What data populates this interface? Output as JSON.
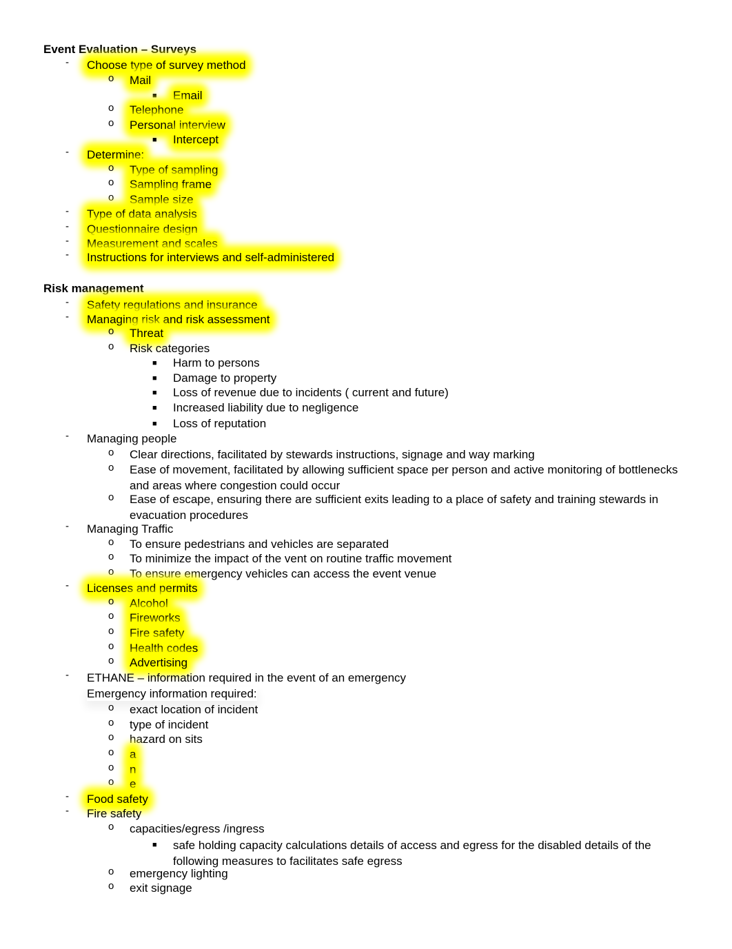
{
  "sections": [
    {
      "title": "Event Evaluation – Surveys",
      "items": [
        {
          "level": 1,
          "text": "Choose type of survey method",
          "highlight": true
        },
        {
          "level": 2,
          "text": "Mail",
          "highlight": true
        },
        {
          "level": 3,
          "text": "Email",
          "highlight": true
        },
        {
          "level": 2,
          "text": "Telephone",
          "highlight": true
        },
        {
          "level": 2,
          "text": "Personal interview",
          "highlight": true
        },
        {
          "level": 3,
          "text": "Intercept",
          "highlight": true
        },
        {
          "level": 1,
          "text": "Determine:",
          "highlight": true
        },
        {
          "level": 2,
          "text": "Type of sampling",
          "highlight": true
        },
        {
          "level": 2,
          "text": "Sampling frame",
          "highlight": true
        },
        {
          "level": 2,
          "text": "Sample size",
          "highlight": true
        },
        {
          "level": 1,
          "text": "Type of data analysis",
          "highlight": true
        },
        {
          "level": 1,
          "text": "Questionnaire design",
          "highlight": true
        },
        {
          "level": 1,
          "text": "Measurement and scales",
          "highlight": true
        },
        {
          "level": 1,
          "text": "Instructions for interviews and self-administered",
          "highlight": true
        }
      ]
    },
    {
      "title": "Risk management",
      "items": [
        {
          "level": 1,
          "text": "Safety regulations and insurance",
          "highlight": true
        },
        {
          "level": 1,
          "text": "Managing risk and risk assessment",
          "highlight": true
        },
        {
          "level": 2,
          "text": "Threat",
          "highlight": true
        },
        {
          "level": 2,
          "text": "Risk categories",
          "highlight": false
        },
        {
          "level": 3,
          "text": "Harm to persons",
          "highlight": false
        },
        {
          "level": 3,
          "text": "Damage to property",
          "highlight": false
        },
        {
          "level": 3,
          "text": "Loss of revenue due to incidents ( current and future)",
          "highlight": false
        },
        {
          "level": 3,
          "text": "Increased liability due to negligence",
          "highlight": false
        },
        {
          "level": 3,
          "text": "Loss of reputation",
          "highlight": false
        },
        {
          "level": 1,
          "text": "Managing people",
          "highlight": false
        },
        {
          "level": 2,
          "text": "Clear directions, facilitated by stewards instructions, signage and way marking",
          "highlight": false
        },
        {
          "level": 2,
          "text": "Ease of movement, facilitated by allowing sufficient space per person and active monitoring of bottlenecks and areas where congestion could occur",
          "highlight": false
        },
        {
          "level": 2,
          "text": "Ease of escape, ensuring there are sufficient exits leading to a place of safety and training stewards in evacuation procedures",
          "highlight": false
        },
        {
          "level": 1,
          "text": "Managing Traffic",
          "highlight": false
        },
        {
          "level": 2,
          "text": "To ensure pedestrians and vehicles are separated",
          "highlight": false
        },
        {
          "level": 2,
          "text": "To minimize the impact of the vent on routine traffic movement",
          "highlight": false
        },
        {
          "level": 2,
          "text": "To ensure emergency vehicles can access the event venue",
          "highlight": false
        },
        {
          "level": 1,
          "text": "Licenses and permits",
          "highlight": true
        },
        {
          "level": 2,
          "text": "Alcohol",
          "highlight": true
        },
        {
          "level": 2,
          "text": "Fireworks",
          "highlight": true
        },
        {
          "level": 2,
          "text": "Fire safety",
          "highlight": true
        },
        {
          "level": 2,
          "text": "Health codes",
          "highlight": true
        },
        {
          "level": 2,
          "text": "Advertising",
          "highlight": true
        },
        {
          "level": 1,
          "text": "ETHANE – information required in the event of an emergency",
          "highlight": false
        },
        {
          "level": 1,
          "text": "Emergency information required:",
          "highlight": false,
          "continuation": true
        },
        {
          "level": 2,
          "text": "exact location of incident",
          "highlight": false
        },
        {
          "level": 2,
          "text": "type of incident",
          "highlight": false
        },
        {
          "level": 2,
          "text": "hazard on sits",
          "highlight": false
        },
        {
          "level": 2,
          "text": "a",
          "highlight": true
        },
        {
          "level": 2,
          "text": "n",
          "highlight": true
        },
        {
          "level": 2,
          "text": "e",
          "highlight": true
        },
        {
          "level": 1,
          "text": "Food safety",
          "highlight": true
        },
        {
          "level": 1,
          "text": "Fire safety",
          "highlight": false
        },
        {
          "level": 2,
          "text": "capacities/egress /ingress",
          "highlight": false
        },
        {
          "level": 3,
          "text": "safe holding capacity calculations details of access and egress for the disabled details of the following measures to facilitates safe egress",
          "highlight": false
        },
        {
          "level": 2,
          "text": "emergency lighting",
          "highlight": false
        },
        {
          "level": 2,
          "text": "exit signage",
          "highlight": false
        }
      ]
    }
  ],
  "markers": {
    "level1": "-",
    "level2": "o",
    "level3": "■"
  },
  "colors": {
    "highlight": "#ffff00",
    "text": "#000000"
  }
}
